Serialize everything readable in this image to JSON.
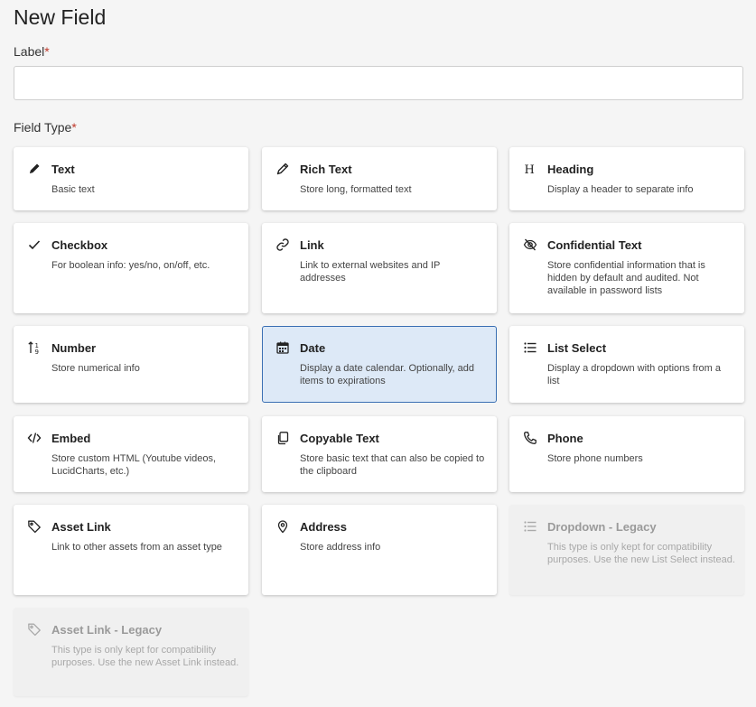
{
  "page": {
    "title": "New Field",
    "label_field": "Label",
    "required_mark": "*",
    "label_value": "",
    "field_type_label": "Field Type",
    "accent": "#3a6fb3",
    "selected_bg": "#dde9f7",
    "required_color": "#c0392b"
  },
  "field_types": [
    {
      "name": "Text",
      "desc": "Basic text",
      "icon": "pencil-icon"
    },
    {
      "name": "Rich Text",
      "desc": "Store long, formatted text",
      "icon": "pen-icon"
    },
    {
      "name": "Heading",
      "desc": "Display a header to separate info",
      "icon": "heading-icon"
    },
    {
      "name": "Checkbox",
      "desc": "For boolean info: yes/no, on/off, etc.",
      "icon": "checkmark-icon"
    },
    {
      "name": "Link",
      "desc": "Link to external websites and IP addresses",
      "icon": "link-icon"
    },
    {
      "name": "Confidential Text",
      "desc": "Store confidential information that is hidden by default and audited. Not available in password lists",
      "icon": "eye-slash-icon"
    },
    {
      "name": "Number",
      "desc": "Store numerical info",
      "icon": "number-sort-icon"
    },
    {
      "name": "Date",
      "desc": "Display a date calendar. Optionally, add items to expirations",
      "icon": "calendar-icon",
      "selected": true
    },
    {
      "name": "List Select",
      "desc": "Display a dropdown with options from a list",
      "icon": "list-icon"
    },
    {
      "name": "Embed",
      "desc": "Store custom HTML (Youtube videos, LucidCharts, etc.)",
      "icon": "code-icon"
    },
    {
      "name": "Copyable Text",
      "desc": "Store basic text that can also be copied to the clipboard",
      "icon": "copy-icon"
    },
    {
      "name": "Phone",
      "desc": "Store phone numbers",
      "icon": "phone-icon"
    },
    {
      "name": "Asset Link",
      "desc": "Link to other assets from an asset type",
      "icon": "tag-icon"
    },
    {
      "name": "Address",
      "desc": "Store address info",
      "icon": "map-pin-icon"
    },
    {
      "name": "Dropdown - Legacy",
      "desc": "This type is only kept for compatibility purposes. Use the new List Select instead.",
      "icon": "list-icon",
      "disabled": true
    },
    {
      "name": "Asset Link - Legacy",
      "desc": "This type is only kept for compatibility purposes. Use the new Asset Link instead.",
      "icon": "tag-icon",
      "disabled": true
    }
  ]
}
